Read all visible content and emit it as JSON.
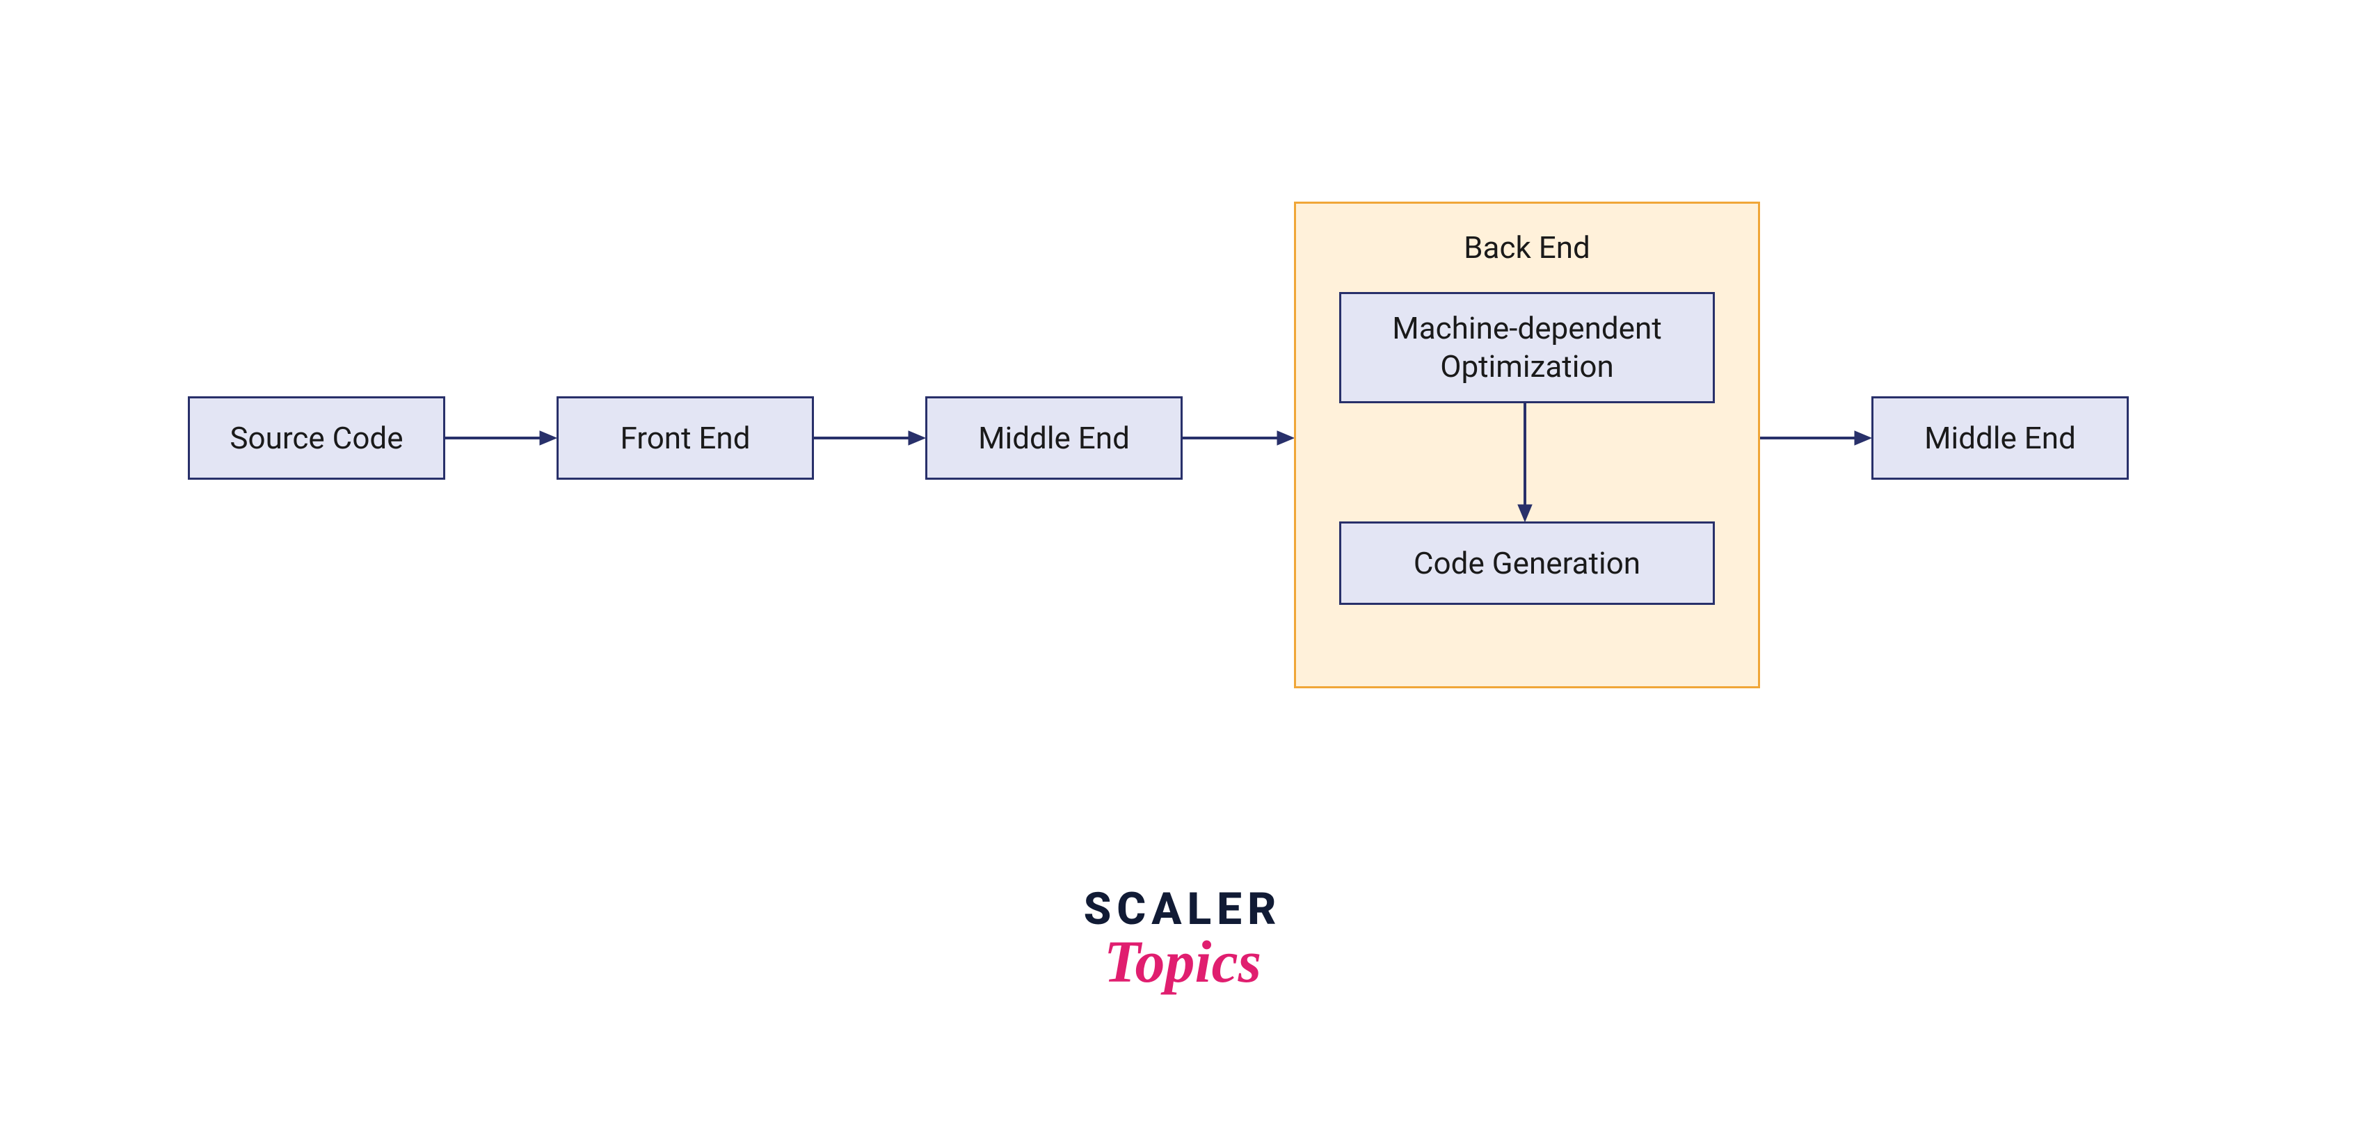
{
  "nodes": {
    "source": "Source Code",
    "front": "Front End",
    "middle1": "Middle End",
    "middle2": "Middle End"
  },
  "backend": {
    "title": "Back End",
    "step1": "Machine-dependent Optimization",
    "step2": "Code Generation"
  },
  "logo": {
    "line1": "SCALER",
    "line2": "Topics"
  },
  "colors": {
    "node_border": "#28306a",
    "node_fill": "#e3e5f4",
    "backend_border": "#f0a638",
    "backend_fill": "#fff1da",
    "arrow": "#28306a",
    "logo_dark": "#111b35",
    "logo_pink": "#e01e6f"
  }
}
